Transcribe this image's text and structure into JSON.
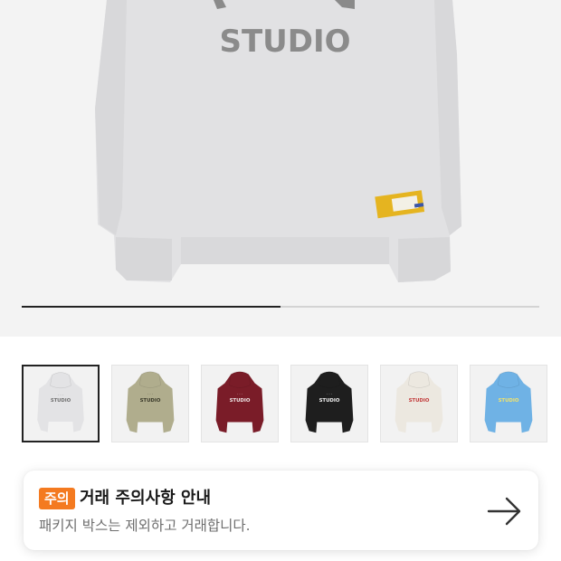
{
  "product_image": {
    "print_text": "STUDIO",
    "carousel_progress": 0.5
  },
  "thumbnails": [
    {
      "color_name": "gray",
      "body": "#e3e3e5",
      "print": "#6f6f6f",
      "print_text": "STUDIO",
      "selected": true
    },
    {
      "color_name": "khaki",
      "body": "#b0ad8d",
      "print": "#3a3a2a",
      "print_text": "STUDIO",
      "selected": false
    },
    {
      "color_name": "burgundy",
      "body": "#7a1c28",
      "print": "#f0e8e8",
      "print_text": "STUDIO",
      "selected": false
    },
    {
      "color_name": "black",
      "body": "#1e1e1e",
      "print": "#f2f2f2",
      "print_text": "STUDIO",
      "selected": false
    },
    {
      "color_name": "cream",
      "body": "#ece8e0",
      "print": "#c23a3a",
      "print_text": "STUDIO",
      "selected": false
    },
    {
      "color_name": "sky-blue",
      "body": "#6fb2e5",
      "print": "#f3e36a",
      "print_text": "STUDIO",
      "selected": false
    }
  ],
  "notice": {
    "badge": "주의",
    "title": "거래 주의사항 안내",
    "description": "패키지 박스는 제외하고 거래합니다.",
    "arrow_icon": "arrow-right-icon"
  },
  "colors": {
    "accent": "#f47a20",
    "hero_bg": "#f3f3f3"
  }
}
